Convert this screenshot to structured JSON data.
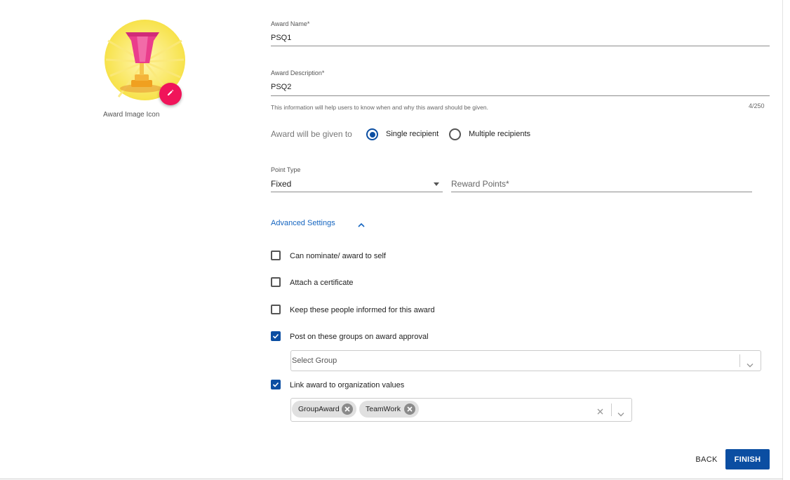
{
  "image_panel": {
    "caption": "Award Image Icon"
  },
  "award_name": {
    "label": "Award Name*",
    "value": "PSQ1"
  },
  "award_description": {
    "label": "Award Description*",
    "value": "PSQ2",
    "helper": "This information will help users to know when and why this award should be given.",
    "counter": "4/250"
  },
  "given_to": {
    "label": "Award will be given to",
    "options": [
      {
        "label": "Single recipient",
        "selected": true
      },
      {
        "label": "Multiple recipients",
        "selected": false
      }
    ]
  },
  "point_type": {
    "label": "Point Type",
    "value": "Fixed"
  },
  "reward_points": {
    "placeholder": "Reward Points*"
  },
  "advanced_settings": {
    "label": "Advanced Settings",
    "options": [
      {
        "label": "Can nominate/ award to self",
        "checked": false
      },
      {
        "label": "Attach a certificate",
        "checked": false
      },
      {
        "label": "Keep these people informed for this award",
        "checked": false
      },
      {
        "label": "Post on these groups on award approval",
        "checked": true
      },
      {
        "label": "Link award to organization values",
        "checked": true
      }
    ],
    "group_select": {
      "placeholder": "Select Group"
    },
    "values_select": {
      "chips": [
        "GroupAward",
        "TeamWork"
      ]
    }
  },
  "actions": {
    "back": "BACK",
    "finish": "FINISH"
  },
  "colors": {
    "primary": "#0b4ea2",
    "accent": "#f0145a",
    "link": "#1565c0"
  }
}
